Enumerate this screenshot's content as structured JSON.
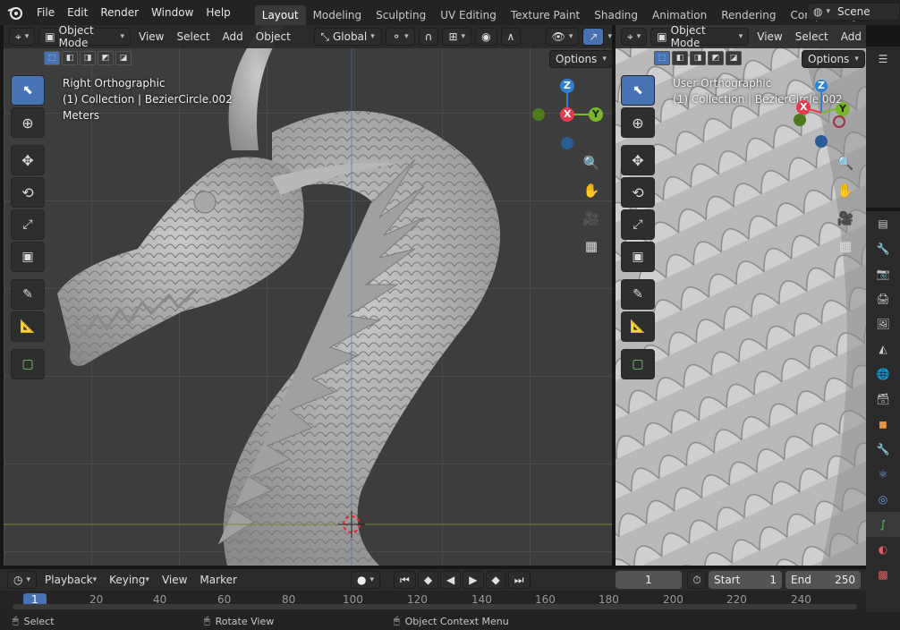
{
  "topbar": {
    "menus": [
      "File",
      "Edit",
      "Render",
      "Window",
      "Help"
    ],
    "workspaces": [
      "Layout",
      "Modeling",
      "Sculpting",
      "UV Editing",
      "Texture Paint",
      "Shading",
      "Animation",
      "Rendering",
      "Compositing"
    ],
    "scene_label": "Scene"
  },
  "left_view": {
    "mode": "Object Mode",
    "menus": [
      "View",
      "Select",
      "Add",
      "Object"
    ],
    "transform": "Global",
    "options": "Options",
    "info": [
      "Right Orthographic",
      "(1) Collection | BezierCircle.002",
      "Meters"
    ],
    "axes": {
      "z": "Z",
      "x": "X",
      "y": "Y"
    }
  },
  "right_view": {
    "mode": "Object Mode",
    "menus": [
      "View",
      "Select",
      "Add"
    ],
    "options": "Options",
    "info": [
      "User Orthographic",
      "(1) Collection | BezierCircle.002"
    ],
    "axes": {
      "z": "Z",
      "x": "X",
      "y": "Y"
    }
  },
  "timeline": {
    "menus": [
      "Playback",
      "Keying",
      "View",
      "Marker"
    ],
    "current_frame": "1",
    "start_label": "Start",
    "start_value": "1",
    "end_label": "End",
    "end_value": "250",
    "ticks": [
      "1",
      "20",
      "40",
      "60",
      "80",
      "100",
      "120",
      "140",
      "160",
      "180",
      "200",
      "220",
      "240"
    ]
  },
  "status": {
    "select": "Select",
    "rotate": "Rotate View",
    "context": "Object Context Menu"
  },
  "colors": {
    "accent": "#4772b3",
    "x_axis": "#e83a4f",
    "y_axis": "#7ab52a",
    "z_axis": "#2f7fd6"
  }
}
